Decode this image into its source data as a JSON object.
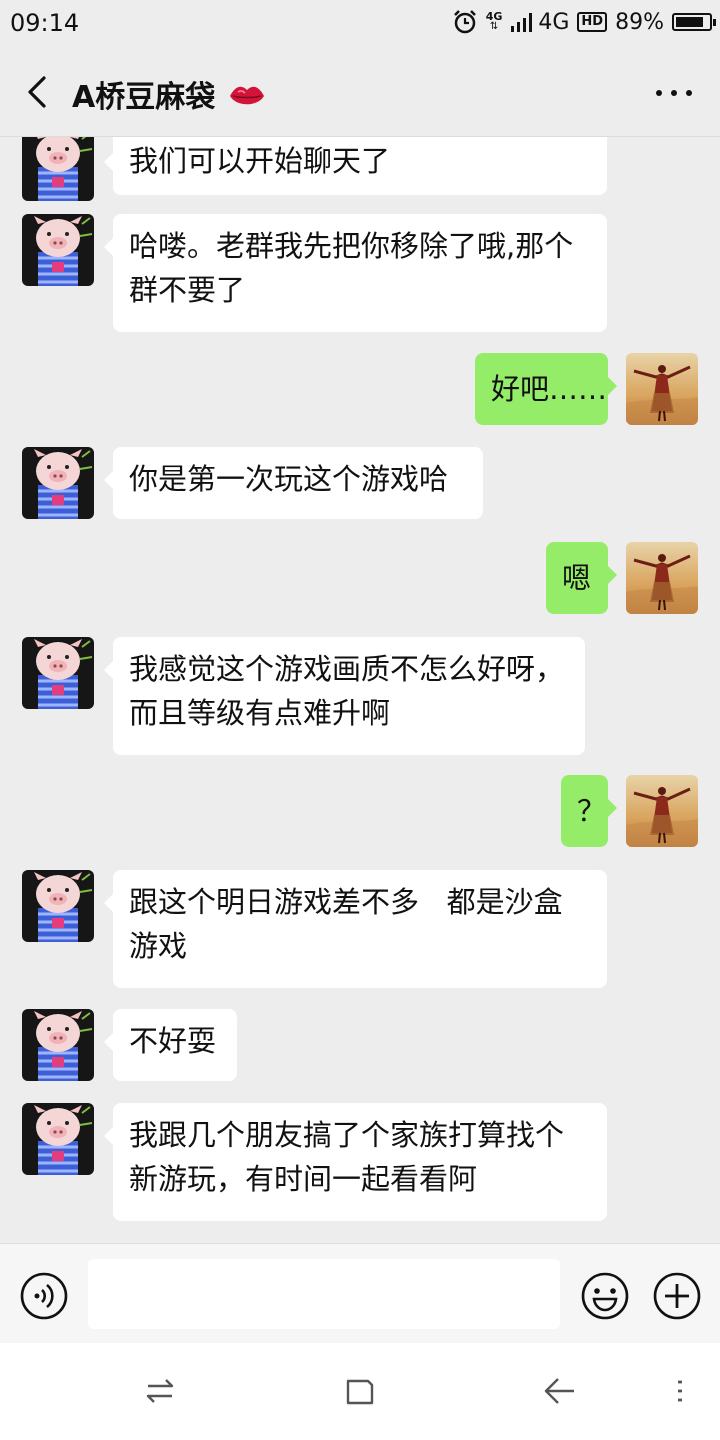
{
  "status_bar": {
    "time": "09:14",
    "network_badge": "4G",
    "signal_label": "4G",
    "hd_label": "HD",
    "battery_text": "89%",
    "battery_level": 0.89,
    "icons": [
      "alarm-clock-icon",
      "data-4g-icon",
      "signal-icon",
      "hd-icon",
      "battery-icon"
    ]
  },
  "header": {
    "title": "A桥豆麻袋",
    "title_emoji": "lips-icon",
    "back_icon": "chevron-left-icon",
    "more_icon": "more-icon"
  },
  "messages": [
    {
      "side": "left",
      "avatar": "pig-avatar",
      "lines": [
        "我们可以开始聊天了"
      ]
    },
    {
      "side": "left",
      "avatar": "pig-avatar",
      "lines": [
        "哈喽。老群我先把你移除了哦,那个",
        "群不要了"
      ]
    },
    {
      "side": "right",
      "avatar": "dancer-avatar",
      "lines": [
        "好吧……"
      ]
    },
    {
      "side": "left",
      "avatar": "pig-avatar",
      "lines": [
        "你是第一次玩这个游戏哈"
      ]
    },
    {
      "side": "right",
      "avatar": "dancer-avatar",
      "lines": [
        "嗯"
      ]
    },
    {
      "side": "left",
      "avatar": "pig-avatar",
      "lines": [
        "我感觉这个游戏画质不怎么好呀，",
        "而且等级有点难升啊"
      ]
    },
    {
      "side": "right",
      "avatar": "dancer-avatar",
      "lines": [
        "？"
      ]
    },
    {
      "side": "left",
      "avatar": "pig-avatar",
      "lines": [
        "跟这个明日游戏差不多   都是沙盒",
        "游戏"
      ]
    },
    {
      "side": "left",
      "avatar": "pig-avatar",
      "lines": [
        "不好耍"
      ]
    },
    {
      "side": "left",
      "avatar": "pig-avatar",
      "lines": [
        "我跟几个朋友搞了个家族打算找个",
        "新游玩，有时间一起看看阿"
      ]
    }
  ],
  "input_bar": {
    "value": "",
    "voice_icon": "voice-icon",
    "emoji_icon": "emoji-icon",
    "plus_icon": "plus-icon"
  },
  "nav_bar": {
    "icons": [
      "switch-icon",
      "home-square-icon",
      "back-arrow-icon",
      "menu-icon"
    ]
  },
  "colors": {
    "background": "#ededed",
    "bubble_left": "#ffffff",
    "bubble_right": "#95ec69"
  }
}
